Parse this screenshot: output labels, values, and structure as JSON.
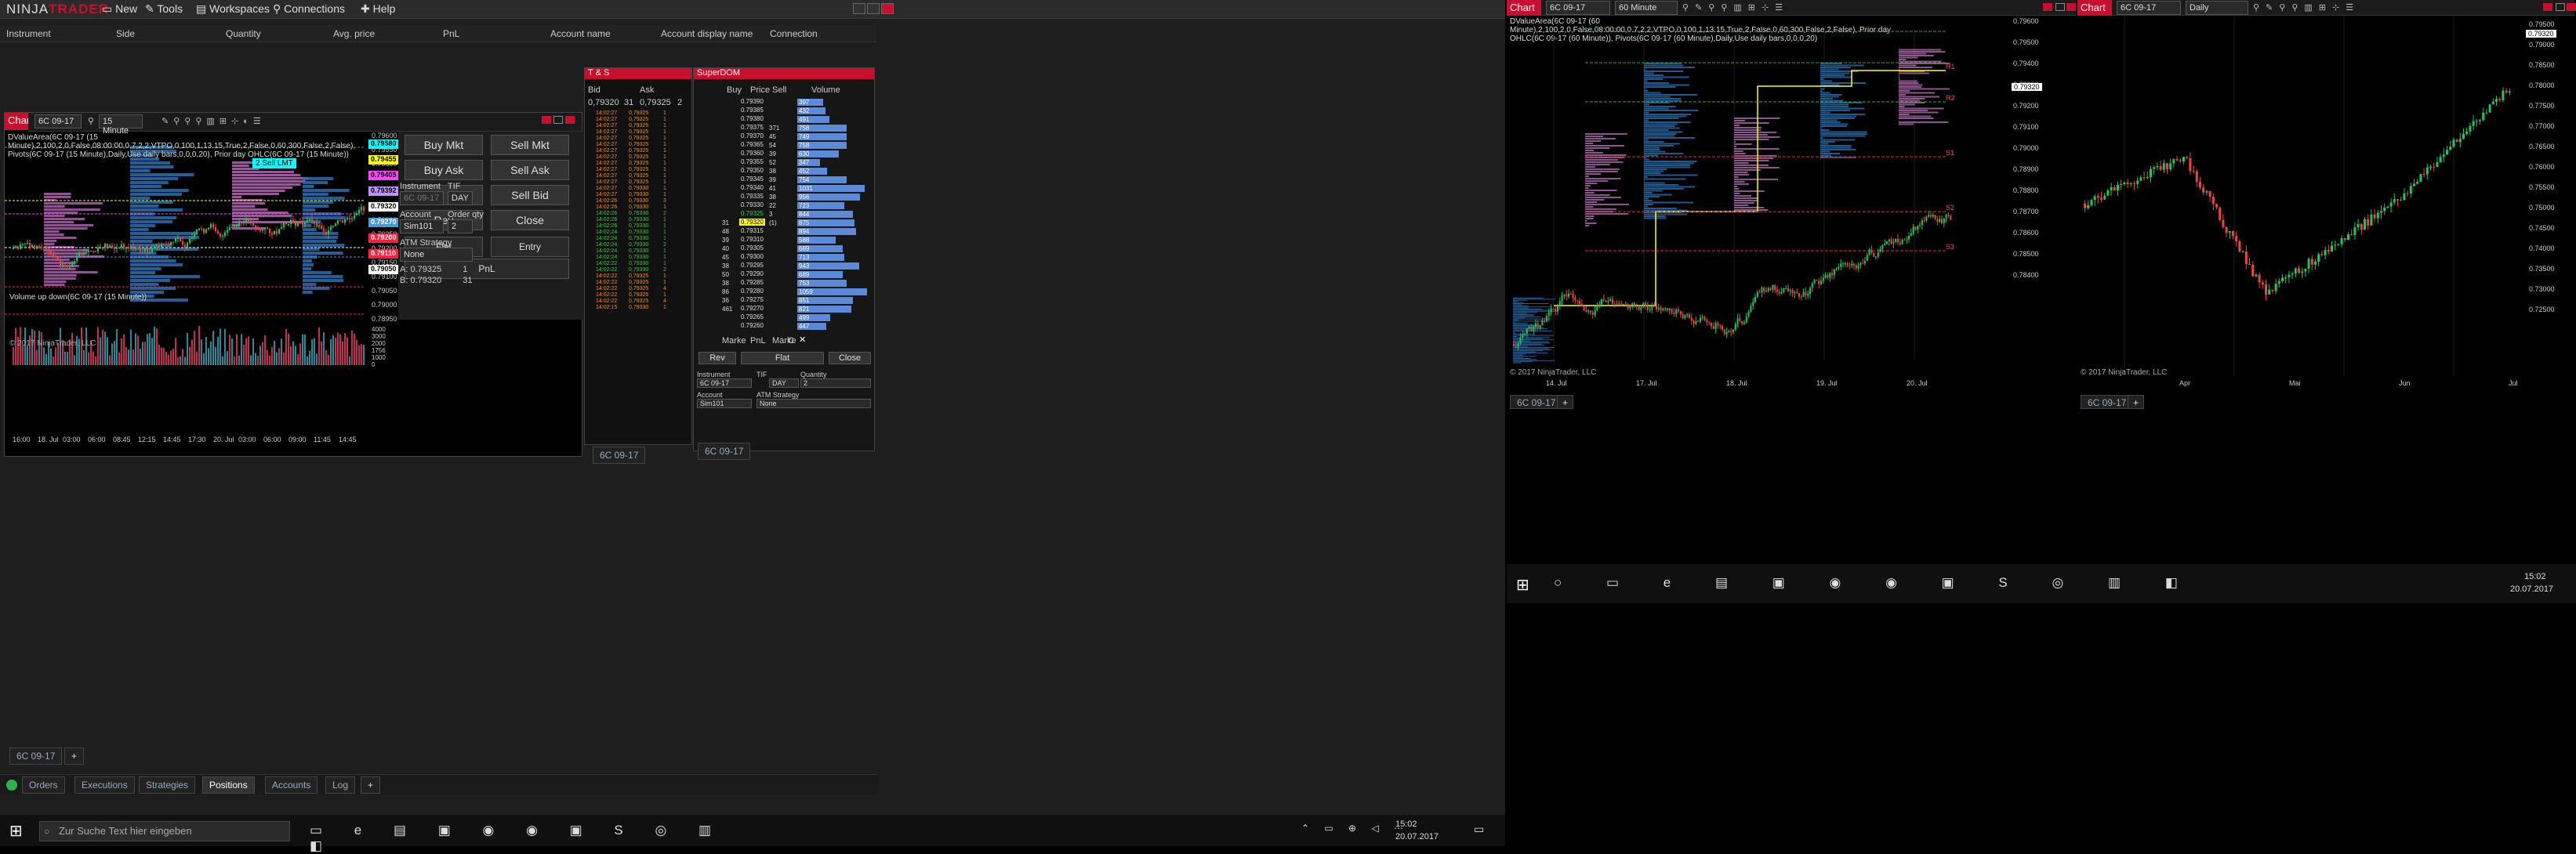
{
  "app": {
    "logo_main": "NINJA",
    "logo_accent": "TRADER",
    "menu": [
      "New",
      "Tools",
      "Workspaces",
      "Connections",
      "Help"
    ]
  },
  "positions_grid": {
    "columns": [
      "Instrument",
      "Side",
      "Quantity",
      "Avg. price",
      "PnL",
      "Account name",
      "Account display name",
      "Connection"
    ]
  },
  "chart1": {
    "title": "Chart",
    "instrument": "6C 09-17",
    "interval": "15 Minute",
    "indicator_text": "DValueArea(6C 09-17 (15 Minute),2,100,2,0,False,08:00:00,0.7,2,2,VTPO,0,100,1,13.15,True,2,False,0,60,300,False,2,False), Pivots(6C 09-17 (15 Minute),Daily,Use daily bars,0,0,0,20), Prior day OHLC(6C 09-17 (15 Minute))",
    "volume_label": "Volume up down(6C 09-17 (15 Minute))",
    "copyright": "© 2017 NinjaTrader, LLC",
    "order_label": "2  Sell LMT",
    "price_axis": [
      "0.79600",
      "0.79550",
      "0.79500",
      "0.79450",
      "0.79400",
      "0.79350",
      "0.79300",
      "0.79250",
      "0.79200",
      "0.79150",
      "0.79100",
      "0.79050",
      "0.79000",
      "0.78950"
    ],
    "tags": [
      {
        "value": "0.79580",
        "color": "#00ffff",
        "text": "#000"
      },
      {
        "value": "0.79455",
        "color": "#ffff00",
        "text": "#000"
      },
      {
        "value": "0.79405",
        "color": "#ff44ff",
        "text": "#000"
      },
      {
        "value": "0.79392",
        "color": "#c090ff",
        "text": "#000"
      },
      {
        "value": "0.79320",
        "color": "#ffffff",
        "text": "#000"
      },
      {
        "value": "0.79270",
        "color": "#4a9ad8",
        "text": "#fff"
      },
      {
        "value": "0.79200",
        "color": "#ff2040",
        "text": "#fff"
      },
      {
        "value": "0.79110",
        "color": "#ff2040",
        "text": "#fff"
      },
      {
        "value": "0.79050",
        "color": "#ffffff",
        "text": "#000"
      }
    ],
    "volume_axis": [
      "4000",
      "3000",
      "2000",
      "1756",
      "1000",
      "0"
    ],
    "time_axis": [
      "16:00",
      "18. Jul",
      "03:00",
      "06:00",
      "08:45",
      "12:15",
      "14:45",
      "17:30",
      "20. Jul",
      "03:00",
      "06:00",
      "09:00",
      "11:45",
      "14:45"
    ],
    "tab": "6C 09-17"
  },
  "chart_trader": {
    "buy_mkt": "Buy Mkt",
    "sell_mkt": "Sell Mkt",
    "buy_ask": "Buy Ask",
    "sell_ask": "Sell Ask",
    "buy_bid": "Buy Bid",
    "sell_bid": "Sell Bid",
    "rev": "Rev",
    "close": "Close",
    "flat": "Flat",
    "entry": "Entry",
    "pnl": "PnL",
    "instrument_label": "Instrument",
    "instrument_value": "6C 09-17",
    "tif_label": "TIF",
    "tif_value": "DAY",
    "account_label": "Account",
    "account_value": "Sim101",
    "order_qty_label": "Order qty",
    "order_qty_value": "2",
    "atm_label": "ATM Strategy",
    "atm_value": "None",
    "ask_row": {
      "label": "A:",
      "price": "0.79325",
      "size": "1"
    },
    "bid_row": {
      "label": "B:",
      "price": "0.79320",
      "size": "31"
    }
  },
  "time_sales": {
    "title": "T & S",
    "bid_header": "Bid",
    "ask_header": "Ask",
    "bid_price": "0,79320",
    "bid_size": "31",
    "ask_price": "0,79325",
    "ask_size": "2",
    "rows": [
      {
        "time": "14:02:27",
        "price": "0,79325",
        "size": "1",
        "color": "#ff8c00"
      },
      {
        "time": "14:02:27",
        "price": "0,79325",
        "size": "1",
        "color": "#ff8c00"
      },
      {
        "time": "14:02:27",
        "price": "0,79325",
        "size": "1",
        "color": "#ff8c00"
      },
      {
        "time": "14:02:27",
        "price": "0,79325",
        "size": "1",
        "color": "#ff8c00"
      },
      {
        "time": "14:02:27",
        "price": "0,79325",
        "size": "1",
        "color": "#ff8c00"
      },
      {
        "time": "14:02:27",
        "price": "0,79325",
        "size": "1",
        "color": "#ff8c00"
      },
      {
        "time": "14:02:27",
        "price": "0,79325",
        "size": "1",
        "color": "#ff8c00"
      },
      {
        "time": "14:02:27",
        "price": "0,79325",
        "size": "1",
        "color": "#ff8c00"
      },
      {
        "time": "14:02:27",
        "price": "0,79325",
        "size": "1",
        "color": "#ff8c00"
      },
      {
        "time": "14:02:27",
        "price": "0,79325",
        "size": "1",
        "color": "#ff8c00"
      },
      {
        "time": "14:02:27",
        "price": "0,79325",
        "size": "1",
        "color": "#ff8c00"
      },
      {
        "time": "14:02:27",
        "price": "0,79325",
        "size": "1",
        "color": "#ff8c00"
      },
      {
        "time": "14:02:27",
        "price": "0,79330",
        "size": "1",
        "color": "#ff8c00"
      },
      {
        "time": "14:02:27",
        "price": "0,79330",
        "size": "1",
        "color": "#ff8c00"
      },
      {
        "time": "14:02:26",
        "price": "0,79330",
        "size": "3",
        "color": "#ff8c00"
      },
      {
        "time": "14:02:26",
        "price": "0,79330",
        "size": "1",
        "color": "#ff8c00"
      },
      {
        "time": "14:02:26",
        "price": "0,79330",
        "size": "2",
        "color": "#33cc33"
      },
      {
        "time": "14:02:26",
        "price": "0,79330",
        "size": "1",
        "color": "#33cc33"
      },
      {
        "time": "14:02:26",
        "price": "0,79330",
        "size": "1",
        "color": "#33cc33"
      },
      {
        "time": "14:02:24",
        "price": "0,79330",
        "size": "1",
        "color": "#33cc33"
      },
      {
        "time": "14:02:24",
        "price": "0,79330",
        "size": "1",
        "color": "#33cc33"
      },
      {
        "time": "14:02:24",
        "price": "0,79330",
        "size": "2",
        "color": "#33cc33"
      },
      {
        "time": "14:02:24",
        "price": "0,79330",
        "size": "1",
        "color": "#33cc33"
      },
      {
        "time": "14:02:24",
        "price": "0,79330",
        "size": "1",
        "color": "#33cc33"
      },
      {
        "time": "14:02:22",
        "price": "0,79330",
        "size": "1",
        "color": "#33cc33"
      },
      {
        "time": "14:02:22",
        "price": "0,79330",
        "size": "2",
        "color": "#33cc33"
      },
      {
        "time": "14:02:22",
        "price": "0,79325",
        "size": "1",
        "color": "#ff8c00"
      },
      {
        "time": "14:02:22",
        "price": "0,79325",
        "size": "1",
        "color": "#ff8c00"
      },
      {
        "time": "14:02:22",
        "price": "0,79325",
        "size": "4",
        "color": "#ff8c00"
      },
      {
        "time": "14:02:22",
        "price": "0,79325",
        "size": "1",
        "color": "#ff8c00"
      },
      {
        "time": "14:02:22",
        "price": "0,79325",
        "size": "4",
        "color": "#ff8c00"
      },
      {
        "time": "14:02:15",
        "price": "0,79330",
        "size": "1",
        "color": "#ff8c00"
      }
    ],
    "tab": "6C 09-17"
  },
  "superdom": {
    "title": "SuperDOM",
    "headers": {
      "buy": "Buy",
      "price": "Price",
      "sell": "Sell",
      "volume": "Volume"
    },
    "rows": [
      {
        "buy": "",
        "price": "0.79390",
        "sell": "",
        "volume": "397"
      },
      {
        "buy": "",
        "price": "0.79385",
        "sell": "",
        "volume": "432"
      },
      {
        "buy": "",
        "price": "0.79380",
        "sell": "",
        "volume": "491"
      },
      {
        "buy": "",
        "price": "0.79375",
        "sell": "371",
        "volume": "758"
      },
      {
        "buy": "",
        "price": "0.79370",
        "sell": "45",
        "volume": "749"
      },
      {
        "buy": "",
        "price": "0.79365",
        "sell": "54",
        "volume": "758"
      },
      {
        "buy": "",
        "price": "0.79360",
        "sell": "39",
        "volume": "630"
      },
      {
        "buy": "",
        "price": "0.79355",
        "sell": "52",
        "volume": "347"
      },
      {
        "buy": "",
        "price": "0.79350",
        "sell": "38",
        "volume": "452"
      },
      {
        "buy": "",
        "price": "0.79345",
        "sell": "39",
        "volume": "754"
      },
      {
        "buy": "",
        "price": "0.79340",
        "sell": "41",
        "volume": "1031"
      },
      {
        "buy": "",
        "price": "0.79335",
        "sell": "38",
        "volume": "956"
      },
      {
        "buy": "",
        "price": "0.79330",
        "sell": "22",
        "volume": "723"
      },
      {
        "buy": "",
        "price": "0.79325",
        "sell": "3",
        "volume": "844"
      },
      {
        "buy": "31",
        "price": "0.79320",
        "sell": "(1)",
        "volume": "875"
      },
      {
        "buy": "48",
        "price": "0.79315",
        "sell": "",
        "volume": "894"
      },
      {
        "buy": "39",
        "price": "0.79310",
        "sell": "",
        "volume": "588"
      },
      {
        "buy": "40",
        "price": "0.79305",
        "sell": "",
        "volume": "689"
      },
      {
        "buy": "45",
        "price": "0.79300",
        "sell": "",
        "volume": "713"
      },
      {
        "buy": "38",
        "price": "0.79295",
        "sell": "",
        "volume": "943"
      },
      {
        "buy": "50",
        "price": "0.79290",
        "sell": "",
        "volume": "689"
      },
      {
        "buy": "38",
        "price": "0.79285",
        "sell": "",
        "volume": "753"
      },
      {
        "buy": "86",
        "price": "0.79280",
        "sell": "",
        "volume": "1059"
      },
      {
        "buy": "36",
        "price": "0.79275",
        "sell": "",
        "volume": "851"
      },
      {
        "buy": "461",
        "price": "0.79270",
        "sell": "",
        "volume": "821"
      },
      {
        "buy": "",
        "price": "0.79265",
        "sell": "",
        "volume": "499"
      },
      {
        "buy": "",
        "price": "0.79260",
        "sell": "",
        "volume": "447"
      }
    ],
    "bottom": {
      "marke_left": "Marke",
      "pnl": "PnL",
      "marke_right": "Marke",
      "c": "C"
    },
    "rev": "Rev",
    "flat": "Flat",
    "close": "Close",
    "instrument_label": "Instrument",
    "instrument_value": "6C 09-17",
    "tif_label": "TIF",
    "tif_value": "DAY",
    "quantity_label": "Quantity",
    "quantity_value": "2",
    "account_label": "Account",
    "account_value": "Sim101",
    "atm_label": "ATM Strategy",
    "atm_value": "None",
    "tab": "6C 09-17"
  },
  "bottom_tabs": [
    "Orders",
    "Executions",
    "Strategies",
    "Positions",
    "Accounts",
    "Log"
  ],
  "taskbar_left": {
    "search_placeholder": "Zur Suche Text hier eingeben",
    "time": "15:02",
    "date": "20.07.2017"
  },
  "chart2": {
    "title": "Chart",
    "instrument": "6C 09-17",
    "interval": "60 Minute",
    "indicator_text": "DValueArea(6C 09-17 (60 Minute),2,100,2,0,False,08:00:00,0.7,2,2,VTPO,0,100,1,13.15,True,2,False,0,60,300,False,2,False), Prior day OHLC(6C 09-17 (60 Minute)), Pivots(6C 09-17 (60 Minute),Daily,Use daily bars,0,0,0,20)",
    "price_axis": [
      "0.79600",
      "0.79500",
      "0.79400",
      "0.79300",
      "0.79200",
      "0.79100",
      "0.79000",
      "0.78900",
      "0.78800",
      "0.78700",
      "0.78600",
      "0.78500",
      "0.78400"
    ],
    "current_price": "0.79320",
    "time_axis": [
      "14. Jul",
      "17. Jul",
      "18. Jul",
      "19. Jul",
      "20. Jul"
    ],
    "pivot_labels": [
      "R1",
      "R2",
      "S1",
      "S2",
      "S3"
    ],
    "copyright": "© 2017 NinjaTrader, LLC",
    "tab": "6C 09-17"
  },
  "chart3": {
    "title": "Chart",
    "instrument": "6C 09-17",
    "interval": "Daily",
    "price_axis": [
      "0.79500",
      "0.79000",
      "0.78500",
      "0.78000",
      "0.77500",
      "0.77000",
      "0.76500",
      "0.76000",
      "0.75500",
      "0.75000",
      "0.74500",
      "0.74000",
      "0.73500",
      "0.73000",
      "0.72500"
    ],
    "current_price": "0.79320",
    "time_axis": [
      "Apr",
      "Mai",
      "Jun",
      "Jul"
    ],
    "copyright": "© 2017 NinjaTrader, LLC",
    "tab": "6C 09-17"
  },
  "taskbar_right": {
    "time": "15:02",
    "date": "20.07.2017"
  },
  "colors": {
    "accent": "#c8102e",
    "bull": "#22c55e",
    "bear": "#ef4444",
    "value_area_blue": "#2a6fb0",
    "value_area_pink": "#c070c0"
  }
}
